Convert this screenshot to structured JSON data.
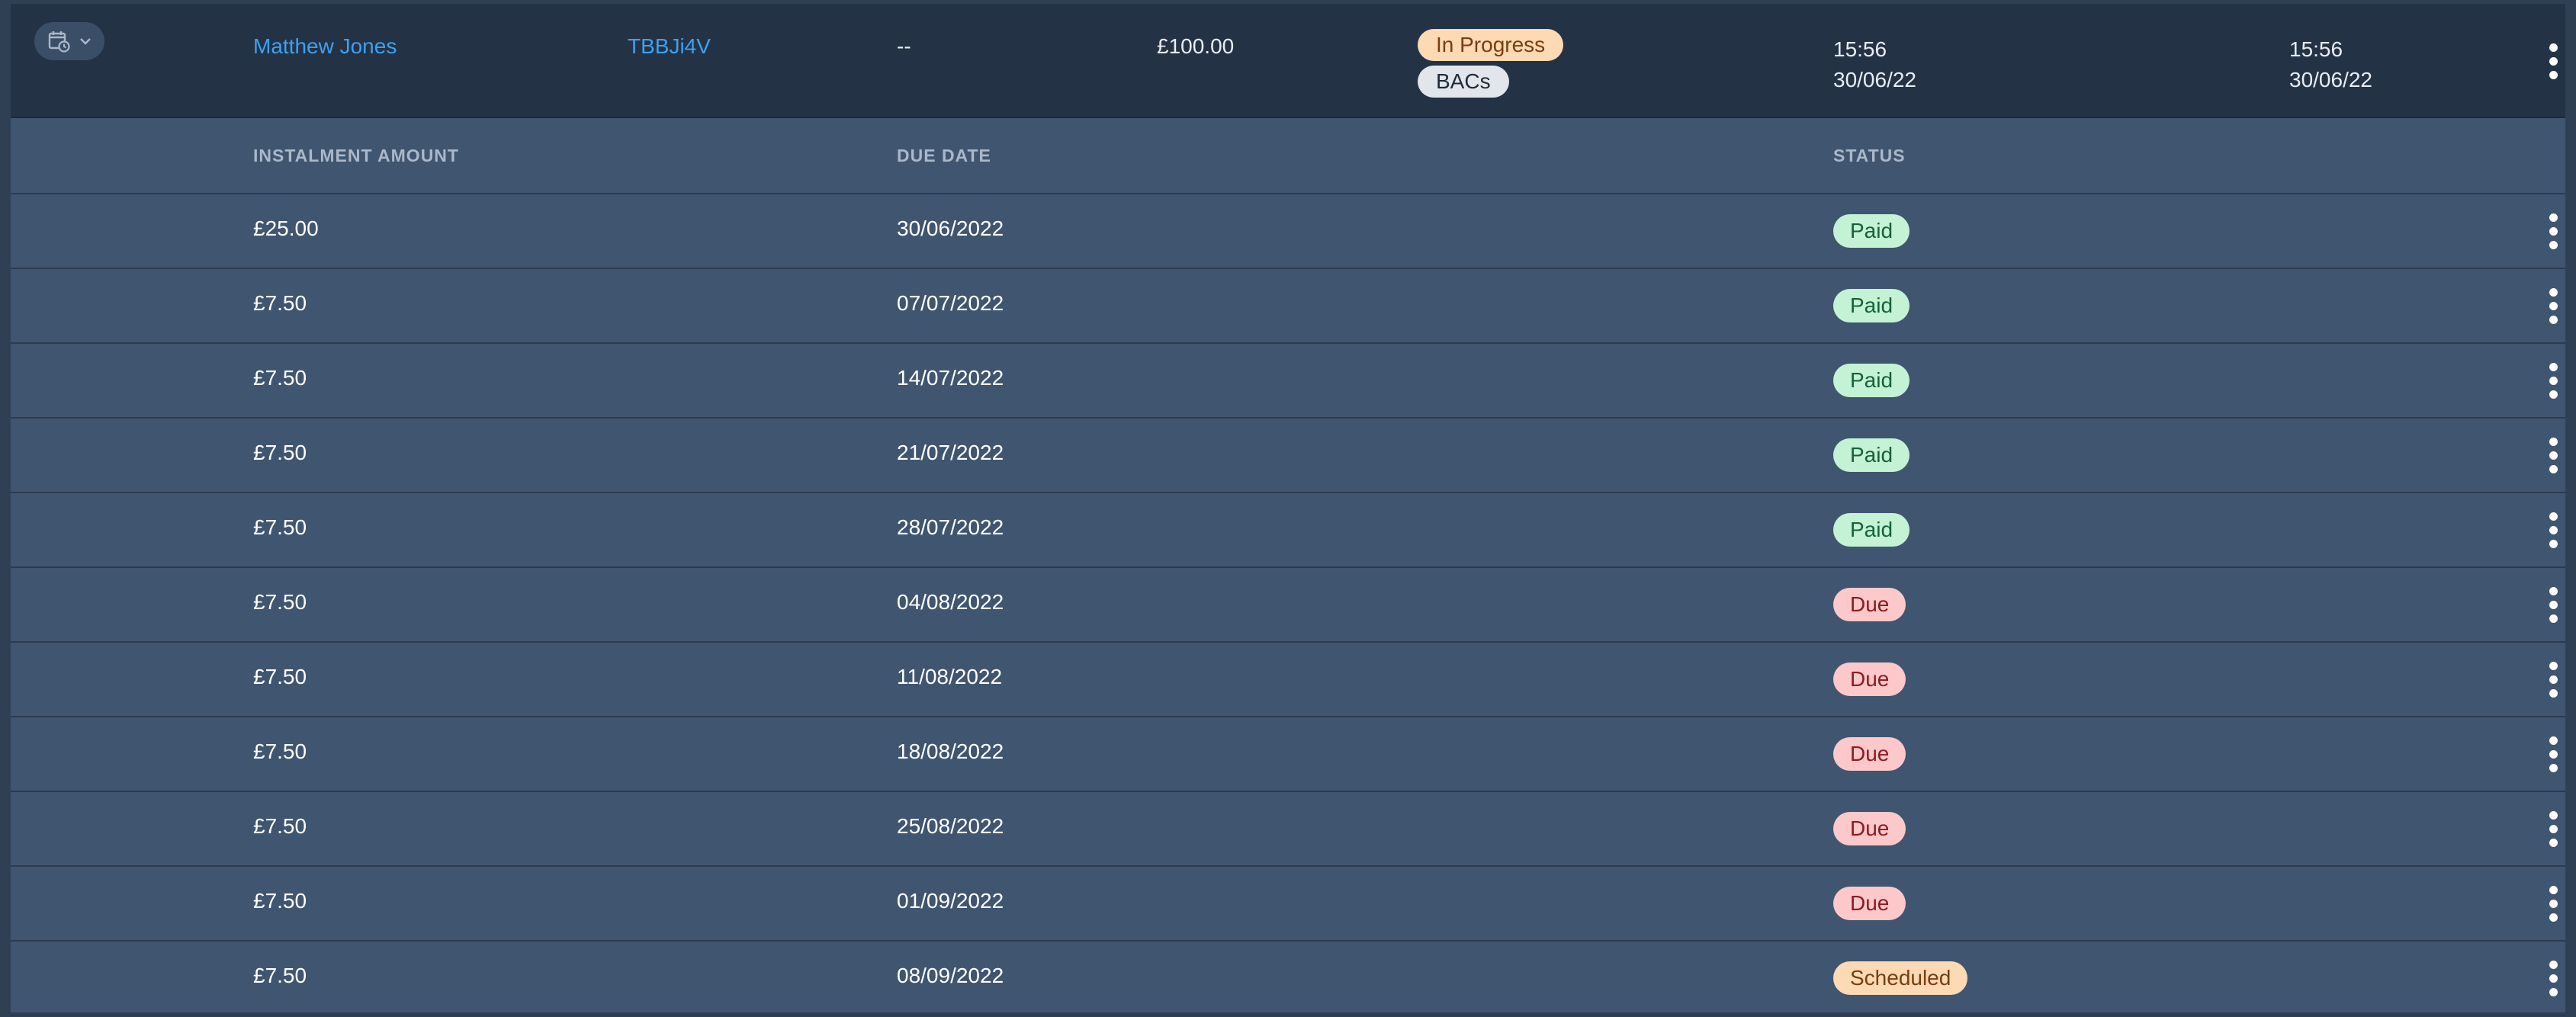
{
  "transaction": {
    "customer_name": "Matthew Jones",
    "reference": "TBBJi4V",
    "placeholder_field": "--",
    "amount": "£100.00",
    "status_badge": "In Progress",
    "method_badge": "BACs",
    "created_time": "15:56",
    "created_date": "30/06/22",
    "updated_time": "15:56",
    "updated_date": "30/06/22",
    "expander_icon": "calendar-clock-icon",
    "expander_chevron": "chevron-down-icon",
    "menu_icon": "kebab-menu-icon"
  },
  "instalments": {
    "headers": {
      "amount": "INSTALMENT AMOUNT",
      "due_date": "DUE DATE",
      "status": "STATUS"
    },
    "rows": [
      {
        "amount": "£25.00",
        "due_date": "30/06/2022",
        "status": "Paid"
      },
      {
        "amount": "£7.50",
        "due_date": "07/07/2022",
        "status": "Paid"
      },
      {
        "amount": "£7.50",
        "due_date": "14/07/2022",
        "status": "Paid"
      },
      {
        "amount": "£7.50",
        "due_date": "21/07/2022",
        "status": "Paid"
      },
      {
        "amount": "£7.50",
        "due_date": "28/07/2022",
        "status": "Paid"
      },
      {
        "amount": "£7.50",
        "due_date": "04/08/2022",
        "status": "Due"
      },
      {
        "amount": "£7.50",
        "due_date": "11/08/2022",
        "status": "Due"
      },
      {
        "amount": "£7.50",
        "due_date": "18/08/2022",
        "status": "Due"
      },
      {
        "amount": "£7.50",
        "due_date": "25/08/2022",
        "status": "Due"
      },
      {
        "amount": "£7.50",
        "due_date": "01/09/2022",
        "status": "Due"
      },
      {
        "amount": "£7.50",
        "due_date": "08/09/2022",
        "status": "Scheduled"
      }
    ]
  },
  "colors": {
    "paid_bg": "#c3f3d4",
    "due_bg": "#fcc8ca",
    "scheduled_bg": "#fdd9b4",
    "link": "#3ea1ef"
  }
}
